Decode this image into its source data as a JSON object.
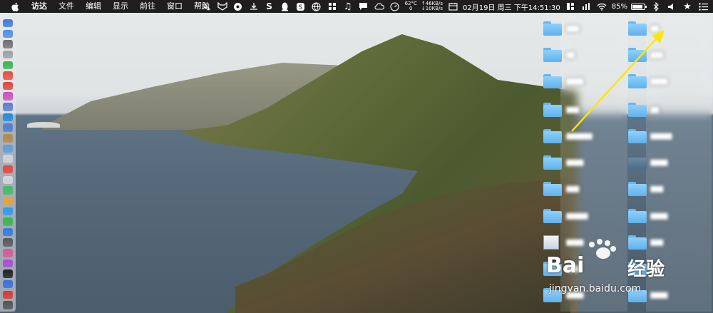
{
  "menubar": {
    "app_name": "访达",
    "menus": [
      "文件",
      "编辑",
      "显示",
      "前往",
      "窗口",
      "帮助"
    ],
    "status": {
      "net_up": "↑46KB/s",
      "net_down": "↓10KB/s",
      "temp": "62°C",
      "temp_sub": "0",
      "datetime": "02月19日 周三 下午14:51:30",
      "battery_percent": "85%",
      "battery_level": 0.85
    }
  },
  "dock": {
    "app_colors": [
      "#3b7bd8",
      "#4a90e2",
      "#6e6e73",
      "#9aa1a8",
      "#3bb34a",
      "#e84b3c",
      "#e0463a",
      "#c850c0",
      "#5a7cd0",
      "#1f8ce0",
      "#4f7fd1",
      "#b38b4a",
      "#5aa0e0",
      "#d0d4da",
      "#e8463a",
      "#d4d8de",
      "#44bb66",
      "#f0a030",
      "#2d9bf0",
      "#39b54a",
      "#2f7de1",
      "#5a5a5e",
      "#d75a9a",
      "#a64ed6",
      "#222222",
      "#3b6fe0",
      "#d93a2f",
      "#555555"
    ]
  },
  "desktop": {
    "left_column_labels": [
      "███",
      "██",
      "████",
      "███",
      "██████",
      "████",
      "███",
      "█████",
      "████",
      "███",
      "████"
    ],
    "right_column_labels": [
      "██",
      "███",
      "████",
      "██",
      "█████",
      "████",
      "███",
      "████",
      "███",
      "██",
      "████"
    ]
  },
  "watermark": {
    "text": "jingyan.baidu.com",
    "logo_text": "Bai",
    "logo_text2": "经验"
  }
}
